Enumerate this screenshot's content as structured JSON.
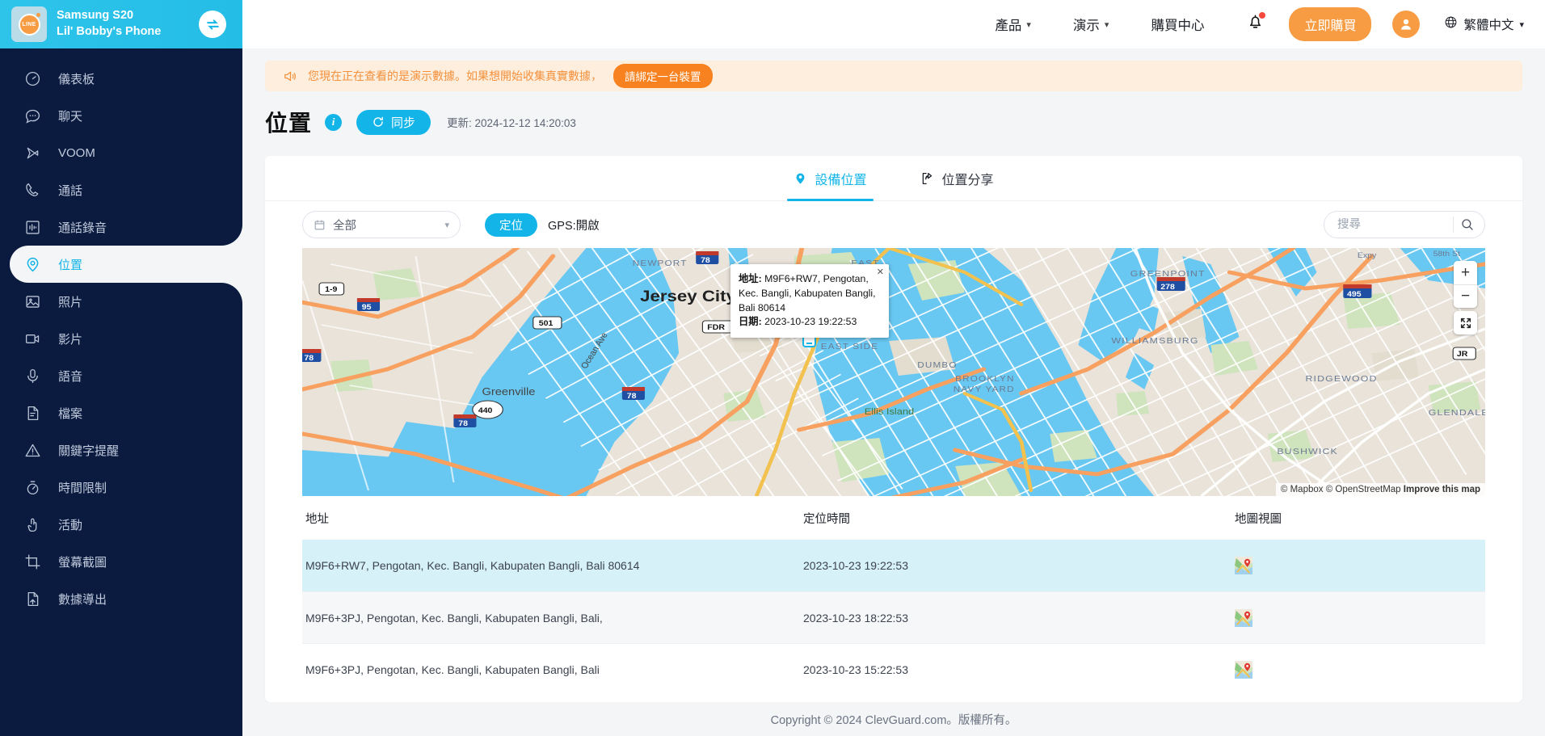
{
  "sidebar": {
    "device_model": "Samsung S20",
    "device_name": "Lil' Bobby's Phone",
    "app_icon": "line-app-icon",
    "toggle_icon": "switch-device-icon",
    "items": [
      {
        "label": "儀表板",
        "icon": "dashboard-gauge-icon",
        "active": false
      },
      {
        "label": "聊天",
        "icon": "chat-bubble-icon",
        "active": false
      },
      {
        "label": "VOOM",
        "icon": "voom-play-icon",
        "active": false
      },
      {
        "label": "通話",
        "icon": "phone-call-icon",
        "active": false
      },
      {
        "label": "通話錄音",
        "icon": "call-recording-icon",
        "active": false
      },
      {
        "label": "位置",
        "icon": "location-pin-icon",
        "active": true
      },
      {
        "label": "照片",
        "icon": "photo-image-icon",
        "active": false
      },
      {
        "label": "影片",
        "icon": "video-camera-icon",
        "active": false
      },
      {
        "label": "語音",
        "icon": "microphone-icon",
        "active": false
      },
      {
        "label": "檔案",
        "icon": "file-document-icon",
        "active": false
      },
      {
        "label": "關鍵字提醒",
        "icon": "warning-triangle-icon",
        "active": false
      },
      {
        "label": "時間限制",
        "icon": "stopwatch-icon",
        "active": false
      },
      {
        "label": "活動",
        "icon": "pointing-hand-icon",
        "active": false
      },
      {
        "label": "螢幕截圖",
        "icon": "screenshot-crop-icon",
        "active": false
      },
      {
        "label": "數據導出",
        "icon": "data-export-icon",
        "active": false
      }
    ]
  },
  "topbar": {
    "nav": [
      {
        "label": "產品",
        "has_caret": true,
        "icon": "chevron-down-icon"
      },
      {
        "label": "演示",
        "has_caret": true,
        "icon": "chevron-down-icon"
      },
      {
        "label": "購買中心",
        "has_caret": false,
        "icon": ""
      }
    ],
    "bell_icon": "notification-bell-icon",
    "buy_label": "立即購買",
    "avatar_icon": "user-avatar-icon",
    "globe_icon": "globe-icon",
    "language": "繁體中文",
    "lang_caret": "chevron-down-icon"
  },
  "banner": {
    "icon": "megaphone-icon",
    "text": "您現在正在查看的是演示數據。如果想開始收集真實數據，",
    "button_label": "請綁定一台裝置",
    "bg_color": "#fdeedd",
    "text_color": "#f4913d",
    "button_color": "#f7821f"
  },
  "page": {
    "title": "位置",
    "info_icon": "info-circle-icon",
    "sync_icon": "sync-refresh-icon",
    "sync_label": "同步",
    "updated_label": "更新: 2024-12-12 14:20:03"
  },
  "tabs": [
    {
      "label": "設備位置",
      "icon": "location-pin-icon",
      "active": true
    },
    {
      "label": "位置分享",
      "icon": "share-location-icon",
      "active": false
    }
  ],
  "filters": {
    "date_icon": "calendar-icon",
    "date_value": "全部",
    "date_caret": "chevron-down-icon",
    "locate_label": "定位",
    "gps_status": "GPS:開啟",
    "search_placeholder": "搜尋",
    "search_value": "",
    "search_icon": "search-icon"
  },
  "map": {
    "provider": "Mapbox",
    "zoom_in_icon": "plus-icon",
    "zoom_out_icon": "minus-icon",
    "fullscreen_icon": "fullscreen-expand-icon",
    "marker_icon": "phone-device-marker-icon",
    "attribution": {
      "mapbox": "© Mapbox",
      "osm": "© OpenStreetMap",
      "improve": "Improve this map"
    },
    "popup": {
      "close_icon": "close-icon",
      "address_label": "地址:",
      "address_value": "M9F6+RW7, Pengotan, Kec. Bangli, Kabupaten Bangli, Bali 80614",
      "date_label": "日期:",
      "date_value": "2023-10-23 19:22:53"
    },
    "labels": [
      "Jersey City",
      "Greenville",
      "Ellis Island",
      "NEWPORT",
      "EAST",
      "LOWER EAST SIDE",
      "DUMBO",
      "BROOKLYN NAVY YARD",
      "GREENPOINT",
      "WILLIAMSBURG",
      "RIDGEWOOD",
      "BUSHWICK",
      "GLENDALE",
      "Ocean Ave",
      "FDR",
      "1-9",
      "95",
      "78",
      "501",
      "440",
      "278",
      "495",
      "JR",
      "58th St",
      "Expy"
    ]
  },
  "table": {
    "columns": [
      "地址",
      "定位時間",
      "地圖視圖"
    ],
    "rows": [
      {
        "address": "M9F6+RW7, Pengotan, Kec. Bangli, Kabupaten Bangli, Bali 80614",
        "time": "2023-10-23 19:22:53",
        "map_icon": "map-thumbnail-icon",
        "highlighted": true
      },
      {
        "address": "M9F6+3PJ, Pengotan, Kec. Bangli, Kabupaten Bangli, Bali,",
        "time": "2023-10-23 18:22:53",
        "map_icon": "map-thumbnail-icon",
        "highlighted": false
      },
      {
        "address": "M9F6+3PJ, Pengotan, Kec. Bangli, Kabupaten Bangli, Bali",
        "time": "2023-10-23 15:22:53",
        "map_icon": "map-thumbnail-icon",
        "highlighted": false
      }
    ]
  },
  "footer": {
    "text": "Copyright © 2024 ClevGuard.com。版權所有。"
  },
  "colors": {
    "sidebar_bg": "#0b1b3f",
    "accent_cyan": "#13b5e8",
    "accent_orange": "#f79c42",
    "highlight_row": "#d6f1f8"
  }
}
